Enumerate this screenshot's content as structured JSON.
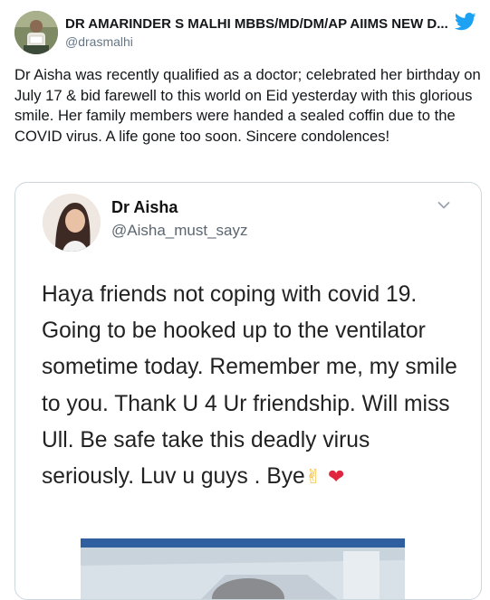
{
  "tweet": {
    "author": {
      "display_name": "DR AMARINDER S MALHI MBBS/MD/DM/AP AIIMS NEW D...",
      "handle": "@drasmalhi",
      "avatar_icon": "profile-photo-icon"
    },
    "platform_icon": "twitter-bird-icon",
    "brand_color": "#1da1f2",
    "text": "Dr Aisha was recently qualified as a doctor; celebrated her birthday on July 17 & bid farewell to this world on Eid yesterday with this glorious smile. Her family members were handed a sealed coffin due to the COVID virus. A life gone too soon. Sincere condolences!"
  },
  "quoted_tweet": {
    "author": {
      "display_name": "Dr Aisha",
      "handle": "@Aisha_must_sayz",
      "avatar_icon": "profile-photo-icon"
    },
    "menu_icon": "chevron-down-icon",
    "text": "Haya friends not coping with covid 19. Going to be hooked up to the ventilator sometime today. Remember me, my smile to you.  Thank U 4 Ur friendship.  Will miss Ull. Be safe take this deadly virus seriously.  Luv u guys . Bye",
    "emoji": [
      "✌",
      "❤"
    ],
    "media_icon": "photo-icon"
  }
}
